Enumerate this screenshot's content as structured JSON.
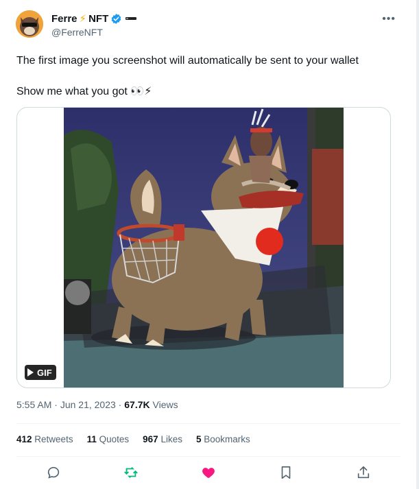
{
  "author": {
    "display_name": "Ferre",
    "name_suffix": "NFT",
    "handle": "@FerreNFT",
    "avatar_icon": "dog-sunglasses-avatar",
    "verified_color": "#1d9bf0"
  },
  "tweet": {
    "line1": "The first image you screenshot will automatically be sent to your wallet",
    "line2": "Show me what you got 👀⚡"
  },
  "media": {
    "badge": "GIF",
    "image_icon": "shiba-dog-basketball-hoop"
  },
  "meta": {
    "time": "5:55 AM",
    "sep1": " · ",
    "date": "Jun 21, 2023",
    "sep2": " · ",
    "views_count": "67.7K",
    "views_label": " Views"
  },
  "stats": [
    {
      "count": "412",
      "label": "Retweets"
    },
    {
      "count": "11",
      "label": "Quotes"
    },
    {
      "count": "967",
      "label": "Likes"
    },
    {
      "count": "5",
      "label": "Bookmarks"
    }
  ],
  "actions": {
    "reply_icon": "reply-icon",
    "retweet_icon": "retweet-icon",
    "like_icon": "heart-icon",
    "bookmark_icon": "bookmark-icon",
    "share_icon": "share-icon",
    "retweet_color": "#00ba7c",
    "like_color": "#f91880"
  }
}
